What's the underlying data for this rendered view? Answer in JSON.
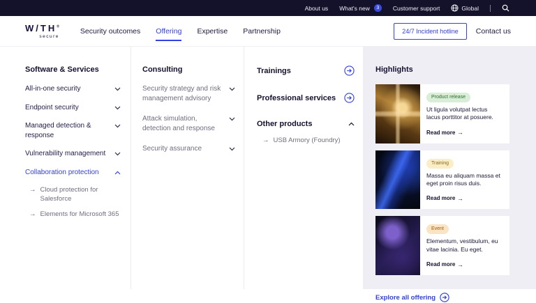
{
  "topbar": {
    "about": "About us",
    "whats_new": "What's new",
    "whats_new_badge": "3",
    "customer_support": "Customer support",
    "global": "Global"
  },
  "nav": {
    "logo_main": "W/TH",
    "logo_mark": "®",
    "logo_sub": "secure",
    "items": [
      {
        "label": "Security outcomes",
        "active": false
      },
      {
        "label": "Offering",
        "active": true
      },
      {
        "label": "Expertise",
        "active": false
      },
      {
        "label": "Partnership",
        "active": false
      }
    ],
    "hotline": "24/7 Incident hotline",
    "contact": "Contact us"
  },
  "menu": {
    "software": {
      "heading": "Software & Services",
      "items": [
        {
          "label": "All-in-one security",
          "state": "collapsed"
        },
        {
          "label": "Endpoint security",
          "state": "collapsed"
        },
        {
          "label": "Managed detection & response",
          "state": "collapsed"
        },
        {
          "label": "Vulnerability management",
          "state": "collapsed"
        },
        {
          "label": "Collaboration protection",
          "state": "expanded",
          "children": [
            "Cloud protection for Salesforce",
            "Elements for Microsoft 365"
          ]
        }
      ]
    },
    "consulting": {
      "heading": "Consulting",
      "items": [
        {
          "label": "Security strategy and risk management advisory"
        },
        {
          "label": "Attack simulation, detection and response"
        },
        {
          "label": "Security assurance"
        }
      ]
    },
    "column3": {
      "trainings": "Trainings",
      "professional": "Professional services",
      "other": "Other products",
      "other_children": [
        "USB Armory (Foundry)"
      ]
    },
    "highlights": {
      "heading": "Highlights",
      "cards": [
        {
          "badge": "Product release",
          "badge_bg": "#d8eed6",
          "badge_fg": "#2f6b33",
          "text": "Ut ligula volutpat lectus lacus porttitor at posuere.",
          "read_more": "Read more"
        },
        {
          "badge": "Training",
          "badge_bg": "#fbeec6",
          "badge_fg": "#8a6a1f",
          "text": "Massa eu aliquam massa et eget proin risus duis.",
          "read_more": "Read more"
        },
        {
          "badge": "Event",
          "badge_bg": "#fbe4c4",
          "badge_fg": "#995a14",
          "text": "Elementum, vestibulum, eu vitae lacinia. Eu eget.",
          "read_more": "Read more"
        }
      ],
      "explore": "Explore all offering"
    }
  },
  "icons": {
    "sub_arrow": "→",
    "read_arrow": "→"
  },
  "colors": {
    "accent_blue": "#3340e4",
    "topbar_bg": "#14112b",
    "badge_blue": "#3b4be0",
    "heading_navy": "#14102f",
    "muted_gray": "#6f6d80",
    "highlights_bg": "#efeef4"
  }
}
